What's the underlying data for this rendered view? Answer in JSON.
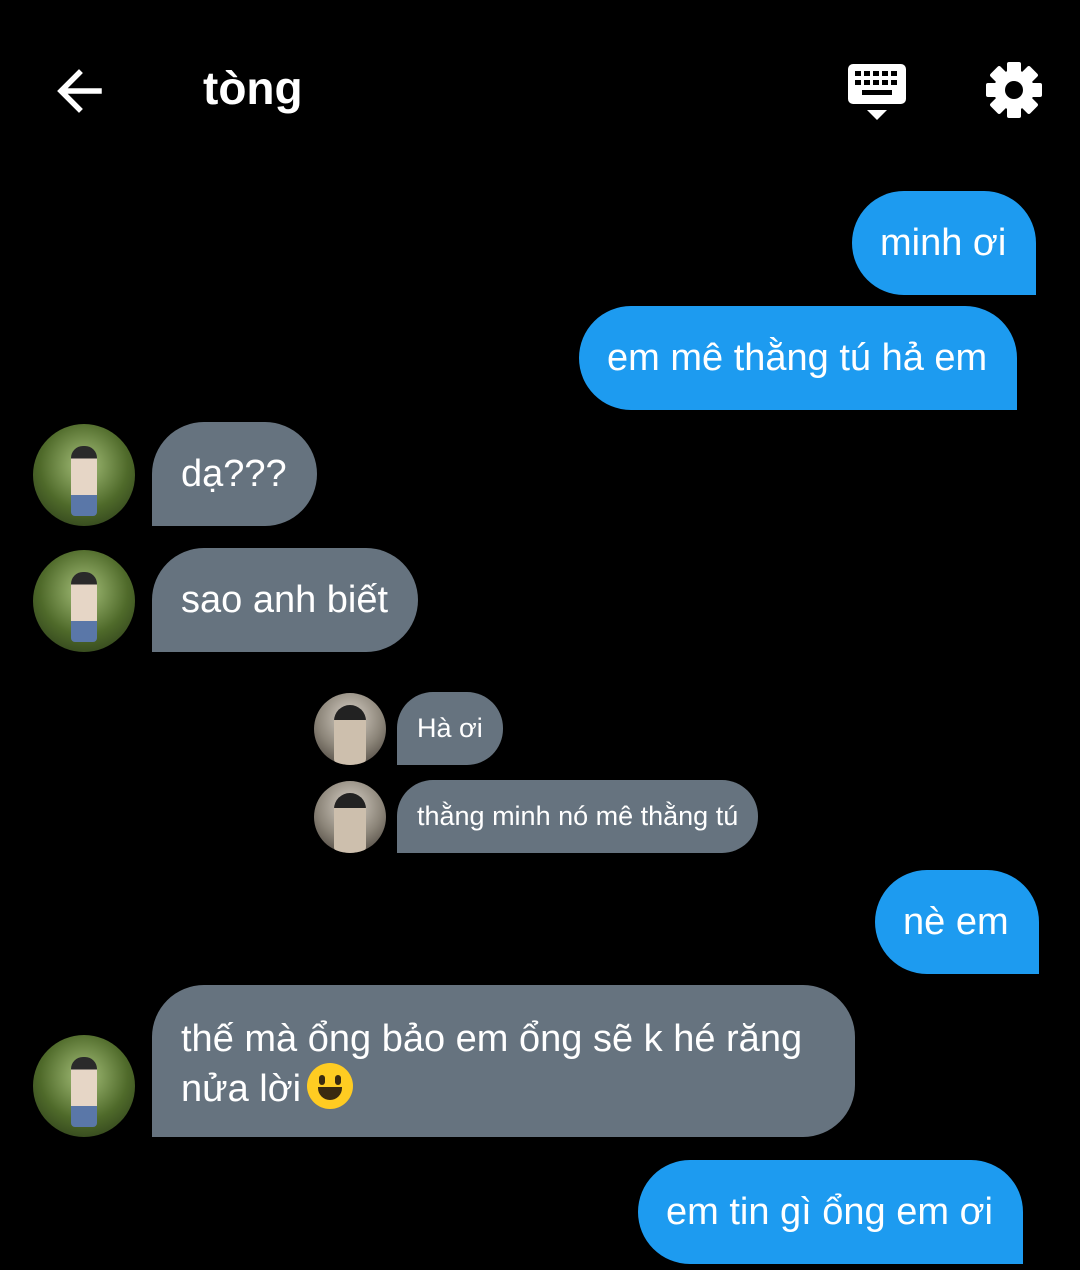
{
  "header": {
    "back_icon": "arrow-left-icon",
    "title": "tòng",
    "keyboard_icon": "keyboard-hide-icon",
    "settings_icon": "gear-icon"
  },
  "colors": {
    "background": "#000000",
    "outgoing_bubble": "#1d9bf0",
    "incoming_bubble": "#66737f",
    "text": "#ffffff"
  },
  "messages": [
    {
      "side": "out",
      "text": "minh ơi"
    },
    {
      "side": "out",
      "text": "em mê thằng tú hả em"
    },
    {
      "side": "in",
      "text": "dạ???"
    },
    {
      "side": "in",
      "text": "sao anh biết"
    },
    {
      "side": "in-quoted",
      "text": "Hà ơi"
    },
    {
      "side": "in-quoted",
      "text": "thằng minh nó mê thằng tú"
    },
    {
      "side": "out",
      "text": "nè em"
    },
    {
      "side": "in",
      "text": "thế mà ổng bảo em ổng sẽ k hé răng nửa lời",
      "emoji": "grinning-face-emoji"
    },
    {
      "side": "out",
      "text": "em tin gì ổng em ơi"
    }
  ]
}
